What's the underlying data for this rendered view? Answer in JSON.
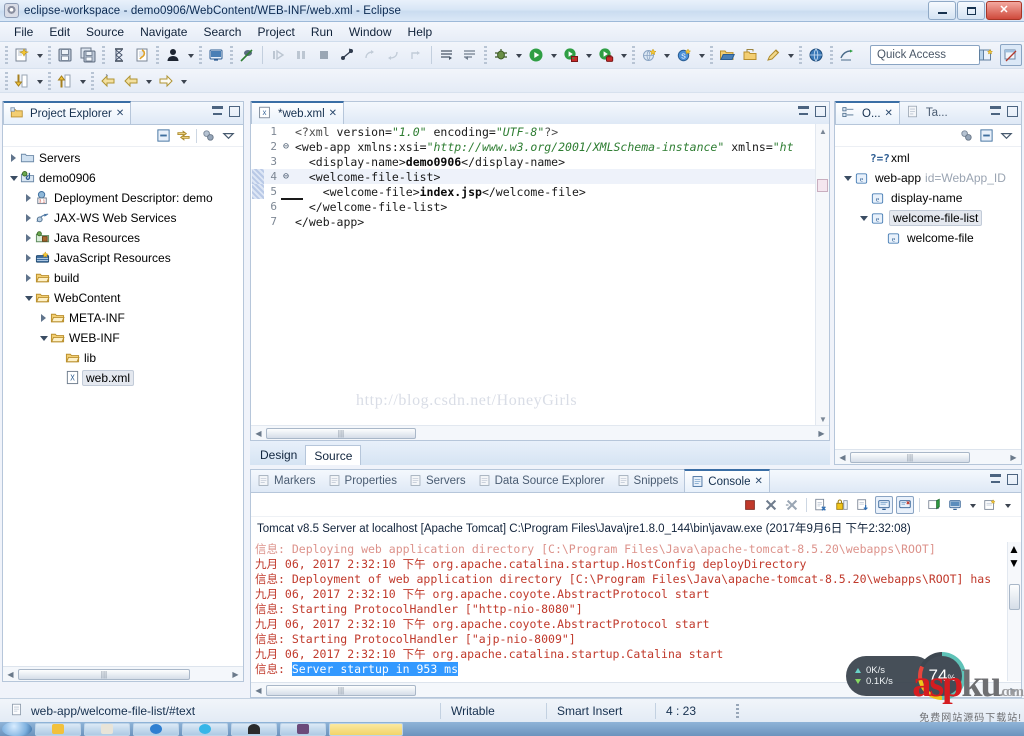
{
  "window": {
    "title": "eclipse-workspace - demo0906/WebContent/WEB-INF/web.xml - Eclipse",
    "icon": "eclipse-icon",
    "minimize": "minimize-button",
    "maximize": "restore-button",
    "close": "close-button"
  },
  "menubar": {
    "items": [
      "File",
      "Edit",
      "Source",
      "Navigate",
      "Search",
      "Project",
      "Run",
      "Window",
      "Help"
    ]
  },
  "toolbar": {
    "quick_access_placeholder": "Quick Access",
    "row1_icons": [
      "new-wizard-icon",
      "new-dropdown-arrow",
      "save-icon",
      "save-all-icon",
      "print-icon",
      "validate-icon",
      "person-icon",
      "person-dropdown-arrow",
      "new-jsp-icon",
      "skip-breakpoints-icon",
      "step-over-run-icon",
      "pause-icon",
      "terminate-icon",
      "disconnect-icon",
      "step-return-icon",
      "step-into-icon",
      "step-out-icon",
      "next-annotation-icon"
    ],
    "row2_icons": [
      "previous-edit-location-icon",
      "down-dropdown-arrow",
      "next-edit-location-icon",
      "up-dropdown-arrow",
      "back-icon",
      "forward-back-icon",
      "back-dropdown-arrow",
      "forward-icon",
      "forward-dropdown-arrow"
    ],
    "row1_right_icons": [
      "open-type-icon",
      "search-icon",
      "debug-icon",
      "debug-dropdown-arrow",
      "run-icon",
      "run-dropdown-arrow",
      "run-as-server-icon",
      "run-as-dropdown-arrow",
      "run-on-server-icon",
      "server-dropdown-arrow",
      "new-web-project-icon",
      "web-dropdown-arrow",
      "new-java-ee-icon",
      "java-ee-dropdown-arrow",
      "open-folder-icon",
      "export-icon",
      "new-annotation-icon",
      "annotation-dropdown-arrow",
      "open-web-browser-icon",
      "profile-icon"
    ],
    "perspective_icons": [
      "open-perspective-icon",
      "java-ee-perspective-icon"
    ]
  },
  "project_explorer": {
    "tab_label": "Project Explorer",
    "tab_icon": "project-explorer-icon",
    "toolbar_icons": [
      "collapse-all-icon",
      "link-with-editor-icon",
      "view-menu-focus-icon",
      "view-menu-icon"
    ],
    "tree": [
      {
        "label": "Servers",
        "icon": "servers-folder-icon",
        "indent": 0,
        "state": "collapsed",
        "selected": false
      },
      {
        "label": "demo0906",
        "icon": "dynamic-web-project-icon",
        "indent": 0,
        "state": "expanded",
        "selected": false
      },
      {
        "label": "Deployment Descriptor: demo",
        "icon": "deployment-descriptor-icon",
        "indent": 1,
        "state": "collapsed",
        "selected": false
      },
      {
        "label": "JAX-WS Web Services",
        "icon": "jaxws-icon",
        "indent": 1,
        "state": "collapsed",
        "selected": false
      },
      {
        "label": "Java Resources",
        "icon": "java-resources-icon",
        "indent": 1,
        "state": "collapsed",
        "selected": false
      },
      {
        "label": "JavaScript Resources",
        "icon": "javascript-resources-icon",
        "indent": 1,
        "state": "collapsed",
        "selected": false
      },
      {
        "label": "build",
        "icon": "folder-icon",
        "indent": 1,
        "state": "collapsed",
        "selected": false
      },
      {
        "label": "WebContent",
        "icon": "folder-icon",
        "indent": 1,
        "state": "expanded",
        "selected": false
      },
      {
        "label": "META-INF",
        "icon": "folder-icon",
        "indent": 2,
        "state": "collapsed",
        "selected": false
      },
      {
        "label": "WEB-INF",
        "icon": "folder-icon",
        "indent": 2,
        "state": "expanded",
        "selected": false
      },
      {
        "label": "lib",
        "icon": "folder-icon",
        "indent": 3,
        "state": "none",
        "selected": false
      },
      {
        "label": "web.xml",
        "icon": "xml-file-icon",
        "indent": 3,
        "state": "none",
        "selected": true
      }
    ],
    "hscroll_present": true
  },
  "editor": {
    "tab_label": "*web.xml",
    "tab_icon": "xml-file-icon",
    "bottom_tabs": [
      {
        "label": "Design",
        "active": false
      },
      {
        "label": "Source",
        "active": true
      }
    ],
    "watermark": "http://blog.csdn.net/HoneyGirls",
    "lines": [
      {
        "num": "1",
        "fold": "",
        "highlight": false,
        "marker": false,
        "tokens": [
          {
            "t": "<?xml ",
            "c": "tk-pi"
          },
          {
            "t": "version=",
            "c": "tk-plain"
          },
          {
            "t": "\"1.0\"",
            "c": "tk-str"
          },
          {
            "t": " encoding=",
            "c": "tk-plain"
          },
          {
            "t": "\"UTF-8\"",
            "c": "tk-str"
          },
          {
            "t": "?>",
            "c": "tk-pi"
          }
        ]
      },
      {
        "num": "2",
        "fold": "⊖",
        "highlight": false,
        "marker": false,
        "tokens": [
          {
            "t": "<web-app ",
            "c": "tk-plain"
          },
          {
            "t": "xmlns:xsi=",
            "c": "tk-plain"
          },
          {
            "t": "\"http://www.w3.org/2001/XMLSchema-instance\"",
            "c": "tk-str"
          },
          {
            "t": " xmlns=",
            "c": "tk-plain"
          },
          {
            "t": "\"ht",
            "c": "tk-str"
          }
        ]
      },
      {
        "num": "3",
        "fold": "",
        "highlight": false,
        "marker": false,
        "tokens": [
          {
            "t": "  <display-name>",
            "c": "tk-plain"
          },
          {
            "t": "demo0906",
            "c": "tk-txt"
          },
          {
            "t": "</display-name>",
            "c": "tk-plain"
          }
        ]
      },
      {
        "num": "4",
        "fold": "⊖",
        "highlight": true,
        "marker": true,
        "tokens": [
          {
            "t": "  <welcome-file-list>",
            "c": "tk-plain"
          }
        ]
      },
      {
        "num": "5",
        "fold": "",
        "highlight": false,
        "marker": true,
        "tokens": [
          {
            "t": "    <welcome-file>",
            "c": "tk-plain"
          },
          {
            "t": "index.jsp",
            "c": "tk-txt"
          },
          {
            "t": "</welcome-file>",
            "c": "tk-plain"
          }
        ]
      },
      {
        "num": "6",
        "fold": "",
        "highlight": false,
        "marker": false,
        "tokens": [
          {
            "t": "  </welcome-file-list>",
            "c": "tk-plain"
          }
        ]
      },
      {
        "num": "7",
        "fold": "",
        "highlight": false,
        "marker": false,
        "tokens": [
          {
            "t": "</web-app>",
            "c": "tk-plain"
          }
        ]
      }
    ]
  },
  "outline": {
    "tabs": [
      {
        "label": "O...",
        "icon": "outline-icon",
        "active": true
      },
      {
        "label": "Ta...",
        "icon": "task-list-icon",
        "active": false
      }
    ],
    "toolbar_icons": [
      "sort-icon",
      "collapse-all-icon",
      "view-menu-icon"
    ],
    "tree": [
      {
        "label": "xml",
        "icon": "processing-instruction-icon",
        "indent": 1,
        "state": "none",
        "selected": false,
        "suffix": ""
      },
      {
        "label": "web-app",
        "icon": "element-icon",
        "indent": 0,
        "state": "expanded",
        "selected": false,
        "suffix": " id=WebApp_ID"
      },
      {
        "label": "display-name",
        "icon": "element-icon",
        "indent": 1,
        "state": "none",
        "selected": false,
        "suffix": ""
      },
      {
        "label": "welcome-file-list",
        "icon": "element-icon",
        "indent": 1,
        "state": "expanded",
        "selected": true,
        "suffix": ""
      },
      {
        "label": "welcome-file",
        "icon": "element-icon",
        "indent": 2,
        "state": "none",
        "selected": false,
        "suffix": ""
      }
    ]
  },
  "bottom_panel": {
    "tabs": [
      {
        "label": "Markers",
        "icon": "markers-icon",
        "active": false
      },
      {
        "label": "Properties",
        "icon": "properties-icon",
        "active": false
      },
      {
        "label": "Servers",
        "icon": "servers-icon",
        "active": false
      },
      {
        "label": "Data Source Explorer",
        "icon": "data-source-explorer-icon",
        "active": false
      },
      {
        "label": "Snippets",
        "icon": "snippets-icon",
        "active": false
      },
      {
        "label": "Console",
        "icon": "console-icon",
        "active": true
      }
    ],
    "toolbar_icons": [
      "terminate-icon",
      "remove-launch-icon",
      "remove-all-terminated-icon",
      "clear-console-icon",
      "lock-scroll-icon",
      "show-console-on-output-icon",
      "pin-console-icon",
      "display-selected-console-icon",
      "open-console-icon",
      "new-console-view-icon",
      "console-dropdown-arrow",
      "console-options-icon",
      "console-options-arrow"
    ],
    "console_title": "Tomcat v8.5 Server at localhost [Apache Tomcat] C:\\Program Files\\Java\\jre1.8.0_144\\bin\\javaw.exe (2017年9月6日 下午2:32:08)",
    "console_lines": [
      {
        "text": "信息: Deploying web application directory [C:\\Program Files\\Java\\apache-tomcat-8.5.20\\webapps\\ROOT]",
        "selected": false,
        "clipped_top": true
      },
      {
        "text": "九月 06, 2017 2:32:10 下午 org.apache.catalina.startup.HostConfig deployDirectory",
        "selected": false
      },
      {
        "text": "信息: Deployment of web application directory [C:\\Program Files\\Java\\apache-tomcat-8.5.20\\webapps\\ROOT] has",
        "selected": false
      },
      {
        "text": "九月 06, 2017 2:32:10 下午 org.apache.coyote.AbstractProtocol start",
        "selected": false
      },
      {
        "text": "信息: Starting ProtocolHandler [\"http-nio-8080\"]",
        "selected": false
      },
      {
        "text": "九月 06, 2017 2:32:10 下午 org.apache.coyote.AbstractProtocol start",
        "selected": false
      },
      {
        "text": "信息: Starting ProtocolHandler [\"ajp-nio-8009\"]",
        "selected": false
      },
      {
        "text": "九月 06, 2017 2:32:10 下午 org.apache.catalina.startup.Catalina start",
        "selected": false
      },
      {
        "text": "信息: ",
        "selected": false,
        "selected_text": "Server startup in 953 ms"
      }
    ]
  },
  "net_widget": {
    "upload": "0K/s",
    "download": "0.1K/s",
    "cpu_percent": "74",
    "percent_symbol": "%"
  },
  "site_watermark": {
    "part1": "asp",
    "part2": "ku",
    "domain": ".com",
    "subtitle": "免费网站源码下载站!"
  },
  "statusbar": {
    "icon": "document-icon",
    "path": "web-app/welcome-file-list/#text",
    "writable": "Writable",
    "insert_mode": "Smart Insert",
    "position": "4 : 23"
  },
  "colors": {
    "accent": "#3a6ea5",
    "console_text": "#c0392b",
    "selection": "#3399ff",
    "string": "#2e7d32",
    "title_text": "#0b2a52"
  }
}
